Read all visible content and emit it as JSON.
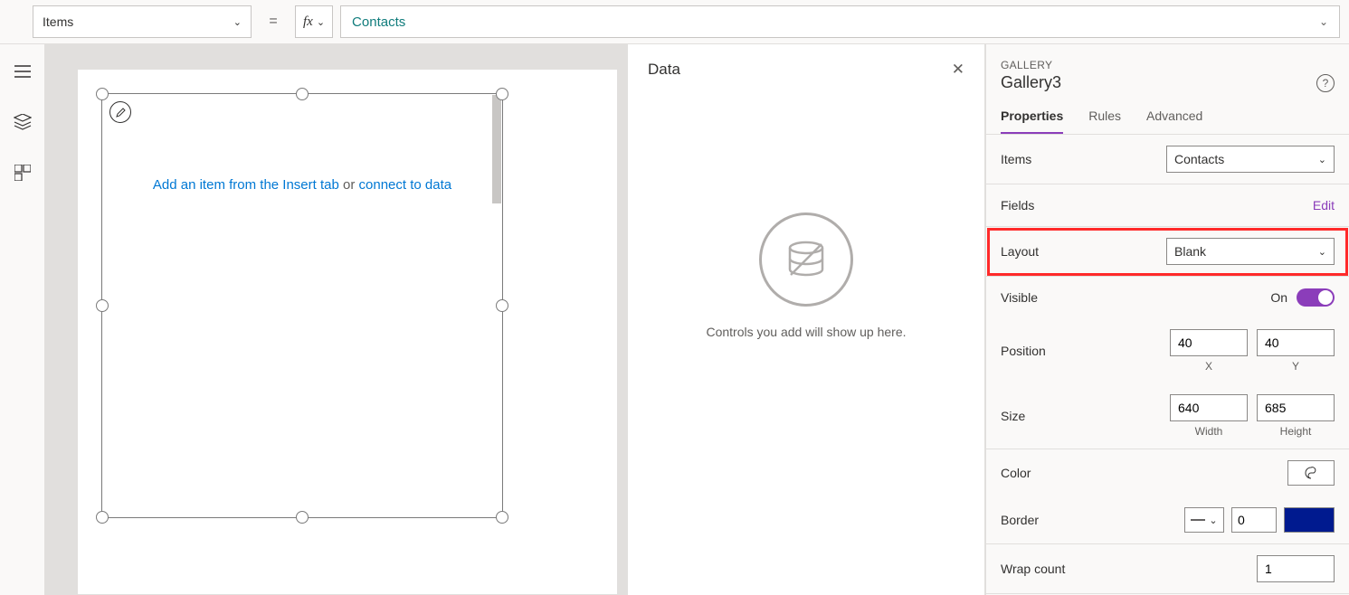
{
  "formula_bar": {
    "property": "Items",
    "value": "Contacts"
  },
  "canvas": {
    "hint_add": "Add an item from the Insert tab",
    "hint_or": " or ",
    "hint_connect": "connect to data"
  },
  "data_panel": {
    "title": "Data",
    "empty": "Controls you add will show up here."
  },
  "props": {
    "caption": "GALLERY",
    "name": "Gallery3",
    "tabs": {
      "properties": "Properties",
      "rules": "Rules",
      "advanced": "Advanced"
    },
    "items": {
      "label": "Items",
      "value": "Contacts"
    },
    "fields": {
      "label": "Fields",
      "edit": "Edit"
    },
    "layout": {
      "label": "Layout",
      "value": "Blank"
    },
    "visible": {
      "label": "Visible",
      "state": "On"
    },
    "position": {
      "label": "Position",
      "x": "40",
      "y": "40",
      "xlabel": "X",
      "ylabel": "Y"
    },
    "size": {
      "label": "Size",
      "w": "640",
      "h": "685",
      "wlabel": "Width",
      "hlabel": "Height"
    },
    "color": {
      "label": "Color"
    },
    "border": {
      "label": "Border",
      "value": "0"
    },
    "wrap": {
      "label": "Wrap count",
      "value": "1"
    }
  }
}
